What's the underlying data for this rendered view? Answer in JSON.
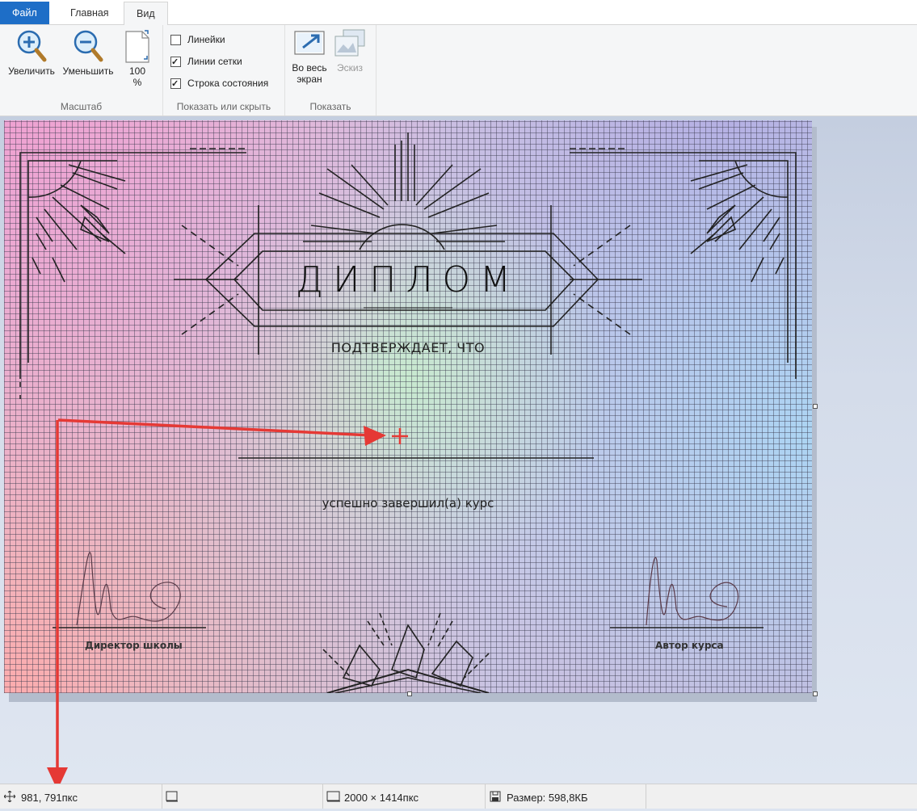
{
  "tabs": {
    "file": "Файл",
    "home": "Главная",
    "view": "Вид"
  },
  "ribbon": {
    "scale_group": {
      "label": "Масштаб",
      "zoom_in": "Увеличить",
      "zoom_out": "Уменьшить",
      "hundred_line1": "100",
      "hundred_line2": "%"
    },
    "showhide_group": {
      "label": "Показать или скрыть",
      "rulers": {
        "label": "Линейки",
        "checked": false
      },
      "gridlines": {
        "label": "Линии сетки",
        "checked": true
      },
      "statusbar": {
        "label": "Строка состояния",
        "checked": true
      }
    },
    "display_group": {
      "label": "Показать",
      "fullscreen_line1": "Во весь",
      "fullscreen_line2": "экран",
      "thumbnail": "Эскиз"
    }
  },
  "document": {
    "title": "ДИПЛОМ",
    "subtitle": "ПОДТВЕРЖДАЕТ, ЧТО",
    "course": "успешно завершил(а) курс",
    "director": "Директор школы",
    "author": "Автор курса"
  },
  "status": {
    "cursor": "981, 791пкс",
    "selection": "",
    "dimensions": "2000 × 1414пкс",
    "size": "Размер: 598,8КБ"
  },
  "colors": {
    "accent": "#1e6ec7",
    "annotation": "#e53935"
  },
  "icons": [
    "zoom-in-icon",
    "zoom-out-icon",
    "page-icon",
    "fullscreen-icon",
    "thumbnail-icon",
    "cursor-move-icon",
    "selection-icon",
    "dimensions-icon",
    "disk-icon"
  ]
}
